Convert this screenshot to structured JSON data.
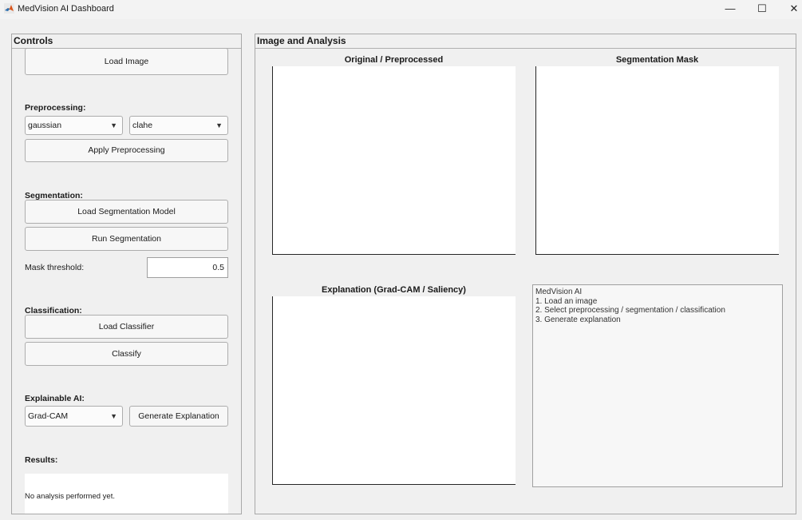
{
  "window": {
    "title": "MedVision AI Dashboard",
    "minimize_glyph": "—",
    "maximize_glyph": "☐",
    "close_glyph": "✕"
  },
  "controls": {
    "title": "Controls",
    "load_image": "Load Image",
    "preprocessing_label": "Preprocessing:",
    "filter_value": "gaussian",
    "enhance_value": "clahe",
    "apply_preprocessing": "Apply Preprocessing",
    "segmentation_label": "Segmentation:",
    "load_seg_model": "Load Segmentation Model",
    "run_segmentation": "Run Segmentation",
    "mask_threshold_label": "Mask threshold:",
    "mask_threshold_value": "0.5",
    "classification_label": "Classification:",
    "load_classifier": "Load Classifier",
    "classify": "Classify",
    "xai_label": "Explainable AI:",
    "xai_method_value": "Grad-CAM",
    "generate_explanation": "Generate Explanation",
    "results_label": "Results:",
    "results_text": "No analysis performed yet."
  },
  "analysis": {
    "title": "Image and Analysis",
    "original_title": "Original / Preprocessed",
    "mask_title": "Segmentation Mask",
    "explanation_title": "Explanation (Grad-CAM / Saliency)",
    "info_lines": [
      "MedVision AI",
      "",
      "1. Load an image",
      "2. Select preprocessing / segmentation / classification",
      "3. Generate explanation"
    ]
  },
  "colors": {
    "window_bg": "#f0f0f0",
    "axes_bg": "#ffffff",
    "border": "#a8a8a8"
  },
  "icons": {
    "app": "matlab-icon",
    "dropdown": "caret-down-icon"
  }
}
